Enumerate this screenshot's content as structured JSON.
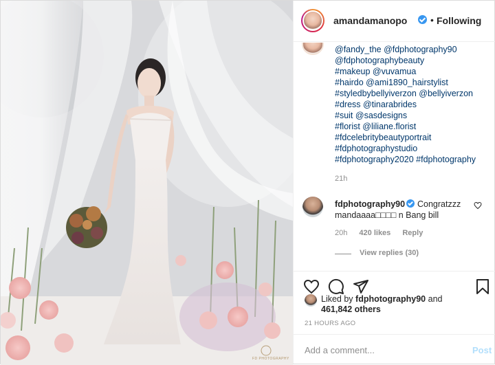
{
  "post": {
    "username": "amandamanopo",
    "separator": "•",
    "follow_status": "Following",
    "photo_watermark": "FD PHOTOGRAPHY",
    "caption_tags": [
      "@fandy_the @fdphotography90",
      "@fdphotographybeauty",
      "#makeup @vuvamua",
      "#hairdo @ami1890_hairstylist",
      "#styledbybellyiverzon @bellyiverzon",
      "#dress @tinarabrides",
      "#suit @sasdesigns",
      "#florist @liliane.florist",
      "#fdcelebritybeautyportrait",
      "#fdphotographystudio",
      "#fdphotography2020 #fdphotography"
    ],
    "caption_time": "21h"
  },
  "comment": {
    "username": "fdphotography90",
    "text_line1": "Congratzzz",
    "text_line2": "mandaaaa□□□□ n Bang bill",
    "time": "20h",
    "likes": "420 likes",
    "reply_label": "Reply",
    "view_replies": "View replies (30)"
  },
  "likes": {
    "prefix": "Liked by",
    "user": "fdphotography90",
    "and": "and",
    "others": "461,842 others"
  },
  "timestamp": "21 HOURS AGO",
  "add_comment": {
    "placeholder": "Add a comment...",
    "post_label": "Post"
  },
  "colors": {
    "link": "#00376b",
    "verified": "#3897f0",
    "muted": "#8e8e8e",
    "post_disabled": "#b2dffc"
  },
  "icons": [
    "heart-icon",
    "comment-icon",
    "share-icon",
    "bookmark-icon",
    "verified-badge-icon"
  ]
}
